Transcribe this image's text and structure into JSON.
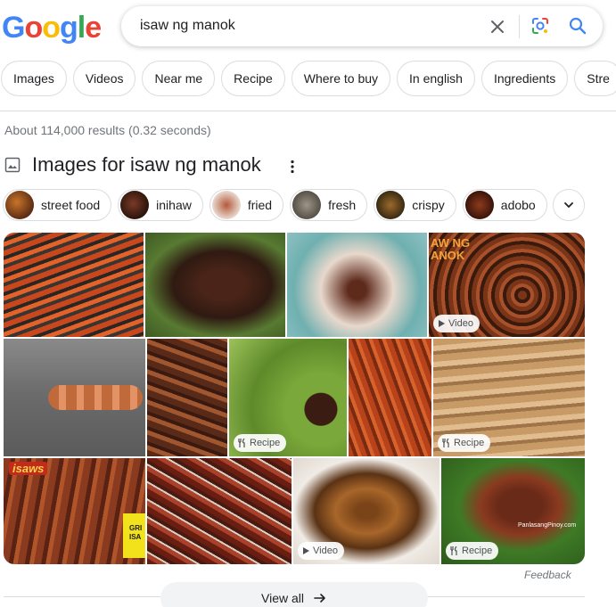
{
  "logo": {
    "letters": [
      "G",
      "o",
      "o",
      "g",
      "l",
      "e"
    ],
    "colors": [
      "#4285F4",
      "#EA4335",
      "#FBBC05",
      "#4285F4",
      "#34A853",
      "#EA4335"
    ]
  },
  "search": {
    "query": "isaw ng manok"
  },
  "filters": [
    "Images",
    "Videos",
    "Near me",
    "Recipe",
    "Where to buy",
    "In english",
    "Ingredients",
    "Stre"
  ],
  "result_stats": "About 114,000 results (0.32 seconds)",
  "images_section": {
    "title": "Images for isaw ng manok",
    "tags": [
      "street food",
      "inihaw",
      "fried",
      "fresh",
      "crispy",
      "adobo"
    ]
  },
  "badges": {
    "video": "Video",
    "recipe": "Recipe"
  },
  "thumb_overlays": {
    "ng": "AW NG",
    "anok": "ANOK",
    "isaws": "isaws",
    "gri": "GRI",
    "isa": "ISA",
    "watermark": "PanlasangPinoy.com"
  },
  "feedback": "Feedback",
  "view_all": "View all",
  "colors": {
    "accent": "#4285F4",
    "chip_border": "#dadce0",
    "meta_text": "#70757a"
  }
}
